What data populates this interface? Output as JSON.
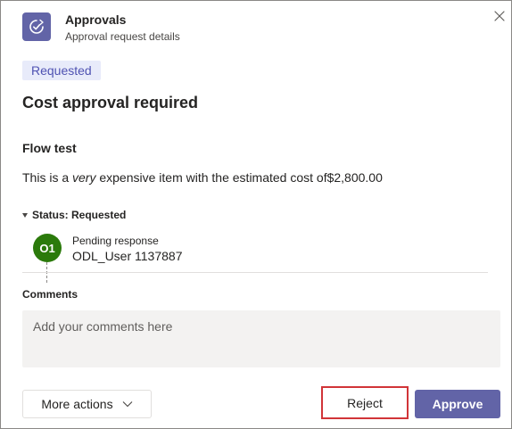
{
  "header": {
    "app_title": "Approvals",
    "app_subtitle": "Approval request details",
    "app_icon": "approvals-check-icon",
    "close_icon": "close-icon"
  },
  "request": {
    "status_pill": "Requested",
    "title": "Cost approval required",
    "flow_name": "Flow test",
    "description_before": "This is a ",
    "description_emphasis": "very",
    "description_after": " expensive item with the estimated cost of$2,800.00"
  },
  "status_section": {
    "label": "Status: Requested",
    "approvers": [
      {
        "initials": "O1",
        "status": "Pending response",
        "name": "ODL_User 1137887"
      }
    ]
  },
  "comments": {
    "label": "Comments",
    "placeholder": "Add your comments here",
    "value": ""
  },
  "footer": {
    "more_actions_label": "More actions",
    "reject_label": "Reject",
    "approve_label": "Approve"
  },
  "colors": {
    "brand": "#6264a7",
    "pill_bg": "#e8ebfa",
    "pill_text": "#4f52b2",
    "avatar": "#2b7a0b",
    "highlight": "#d13438"
  }
}
